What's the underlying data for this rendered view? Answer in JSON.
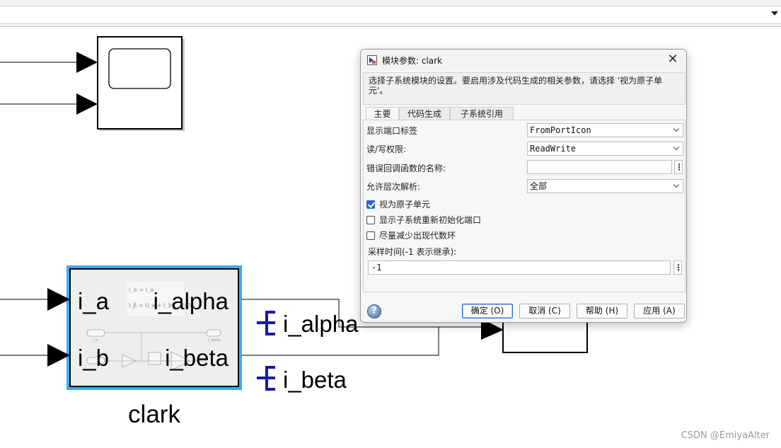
{
  "model": {
    "subsystem_block": {
      "name": "clark",
      "input_ports": [
        "i_a",
        "i_b"
      ],
      "output_ports": [
        "i_alpha",
        "i_beta"
      ],
      "inner_eq1": "i_α = i_a",
      "inner_eq2": "i_β = (i_a + i_b*...)/√3",
      "inner_label_a": "i_a",
      "inner_label_alpha": "i_alpha"
    },
    "goto_tags": [
      "i_alpha",
      "i_beta"
    ]
  },
  "dialog": {
    "title": "模块参数: clark",
    "close_glyph": "✕",
    "description": "选择子系统模块的设置。要启用涉及代码生成的相关参数，请选择 '视为原子单元'。",
    "tabs": [
      {
        "label": "主要",
        "active": true
      },
      {
        "label": "代码生成",
        "active": false
      },
      {
        "label": "子系统引用",
        "active": false
      }
    ],
    "params": {
      "show_port_labels": {
        "label": "显示端口标签",
        "value": "FromPortIcon"
      },
      "read_write": {
        "label": "读/写权限:",
        "value": "ReadWrite"
      },
      "error_callback": {
        "label": "错误回调函数的名称:",
        "value": ""
      },
      "permit_hierarchical": {
        "label": "允许层次解析:",
        "value": "全部"
      },
      "treat_as_atomic": {
        "label": "视为原子单元",
        "checked": true
      },
      "show_reinit_port": {
        "label": "显示子系统重新初始化端口",
        "checked": false
      },
      "minimize_loops": {
        "label": "尽量减少出现代数环",
        "checked": false
      },
      "sample_time": {
        "label": "采样时间(-1 表示继承):",
        "value": "-1"
      }
    },
    "dots_glyph": "⋮",
    "buttons": {
      "ok": "确定 (O)",
      "cancel": "取消 (C)",
      "help": "帮助 (H)",
      "apply": "应用 (A)"
    }
  },
  "watermark": "CSDN @EmiyaAlter",
  "colors": {
    "selection": "#3ea9f5",
    "goto": "#1a1a9c",
    "default_button": "#2f6fd0",
    "checkbox": "#2a64c8"
  }
}
